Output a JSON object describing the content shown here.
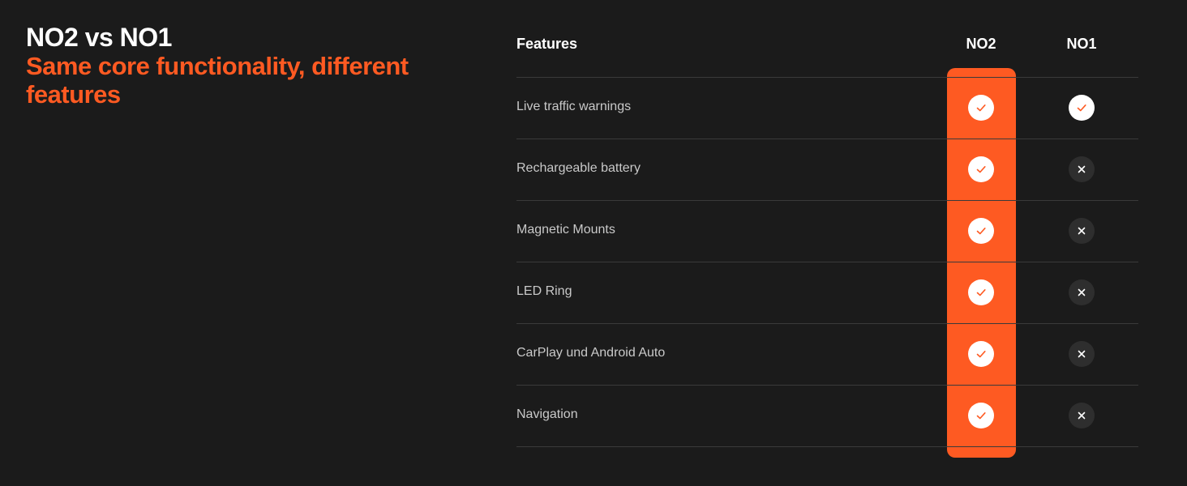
{
  "heading": {
    "title": "NO2 vs NO1",
    "subtitle": "Same core functionality, different features"
  },
  "colors": {
    "background": "#1b1b1b",
    "accent": "#fe5a22",
    "divider": "#3a3a3a",
    "check_bg": "#ffffff",
    "cross_bg": "#2e2e2e"
  },
  "table": {
    "headers": {
      "feature": "Features",
      "no2": "NO2",
      "no1": "NO1"
    },
    "rows": [
      {
        "feature": "Live traffic warnings",
        "no2": "check-icon",
        "no1": "check-icon"
      },
      {
        "feature": "Rechargeable battery",
        "no2": "check-icon",
        "no1": "cross-icon"
      },
      {
        "feature": "Magnetic Mounts",
        "no2": "check-icon",
        "no1": "cross-icon"
      },
      {
        "feature": "LED Ring",
        "no2": "check-icon",
        "no1": "cross-icon"
      },
      {
        "feature": "CarPlay und Android Auto",
        "no2": "check-icon",
        "no1": "cross-icon"
      },
      {
        "feature": "Navigation",
        "no2": "check-icon",
        "no1": "cross-icon"
      }
    ]
  }
}
